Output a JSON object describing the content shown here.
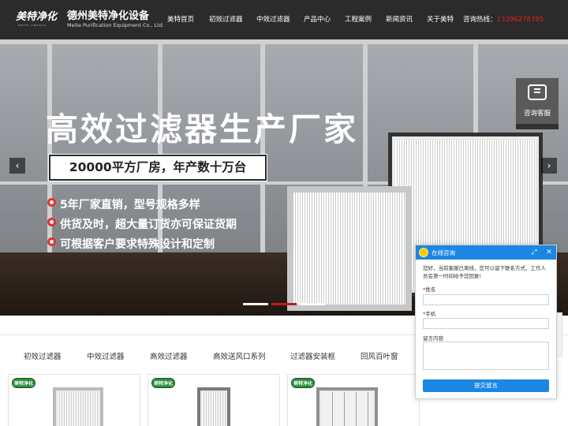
{
  "header": {
    "logo_text": "美特净化",
    "logo_sub": "MEITE JINGHUA",
    "company_name": "德州美特净化设备",
    "company_en": "Meite Purification Equipment Co., Ltd.",
    "nav": [
      "美特首页",
      "初效过滤器",
      "中效过滤器",
      "产品中心",
      "工程案例",
      "新闻资讯",
      "关于美特"
    ],
    "hotline_label": "咨询热线：",
    "hotline_number": "13396278395"
  },
  "banner": {
    "headline": "高效过滤器生产厂家",
    "subhead": "20000平方厂房，年产数十万台",
    "features": [
      "5年厂家直销，型号规格多样",
      "供货及时，超大量订货亦可保证货期",
      "可根据客户要求特殊设计和定制"
    ],
    "prev_arrow": "‹",
    "next_arrow": "›",
    "slide_count": 3,
    "active_slide": 2
  },
  "kefu": {
    "label": "咨询客服"
  },
  "tabs": [
    "初效过滤器",
    "中效过滤器",
    "高效过滤器",
    "高效送风口系列",
    "过滤器安装框",
    "回风百叶窗"
  ],
  "cards": [
    {
      "badge": "美特净化"
    },
    {
      "badge": "美特净化"
    },
    {
      "badge": "美特净化"
    }
  ],
  "chat": {
    "title": "在线咨询",
    "message": "您好，当前客服已离线，您可以留下联系方式，工作人员会第一时间给予您回复!",
    "name_label": "姓名",
    "phone_label": "手机",
    "message_label": "留言内容",
    "submit_label": "提交留言",
    "required_mark": "*",
    "minimize_icon": "⤢",
    "close_icon": "✕"
  },
  "colors": {
    "header_bg": "#2b2b2b",
    "accent_red": "#c8161e",
    "chat_blue": "#1c86e4",
    "badge_green": "#2a8b3a"
  }
}
